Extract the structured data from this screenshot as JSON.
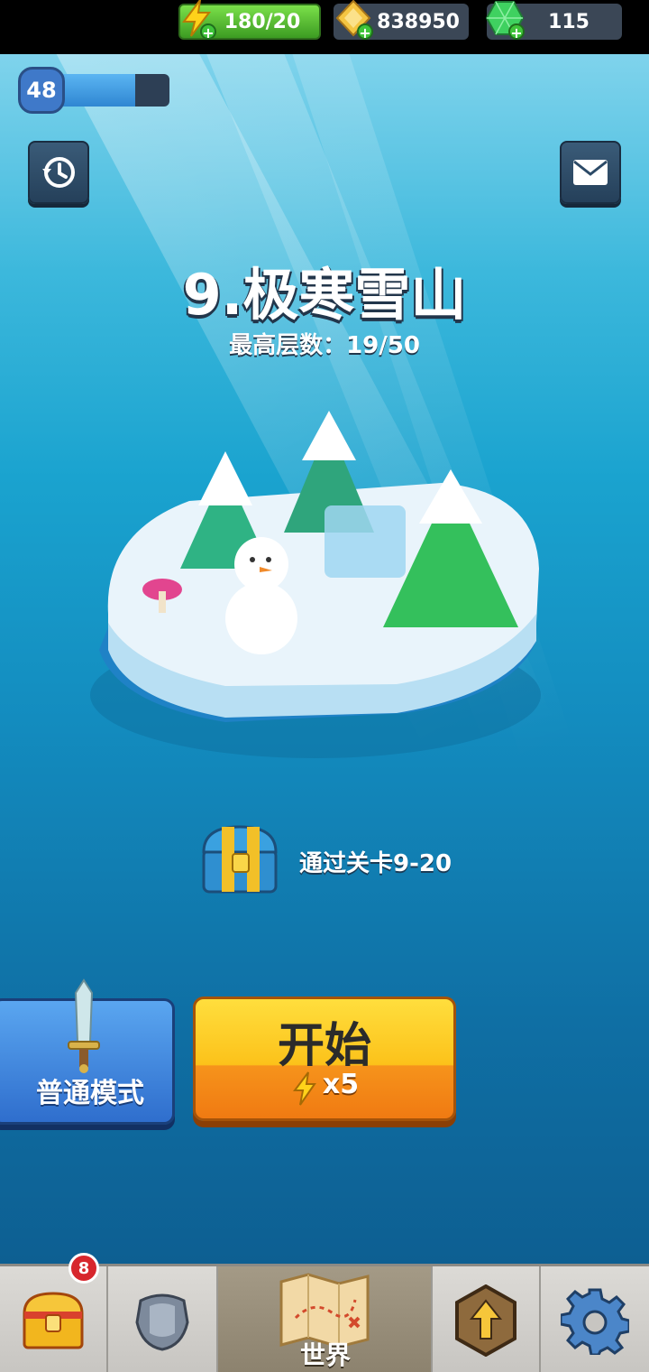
{
  "hud": {
    "level": "48",
    "xp_progress": 0.72,
    "energy": "180/20",
    "gold": "838950",
    "gems": "115"
  },
  "stage": {
    "title": "9.极寒雪山",
    "best_floor": "最高层数：19/50"
  },
  "reward": {
    "text": "通过关卡9-20"
  },
  "actions": {
    "mode_label": "普通模式",
    "start_label": "开始",
    "start_cost": "x5"
  },
  "nav": {
    "badge_count": "8",
    "world_label": "世界",
    "items": [
      "chest",
      "armor",
      "world",
      "upgrade",
      "settings"
    ]
  },
  "colors": {
    "sky_top": "#7fd3ec",
    "sea_bottom": "#0d5f92",
    "start_button": "#fcc21a",
    "mode_button": "#2f6ecd",
    "energy_bar": "#5fd13a"
  }
}
